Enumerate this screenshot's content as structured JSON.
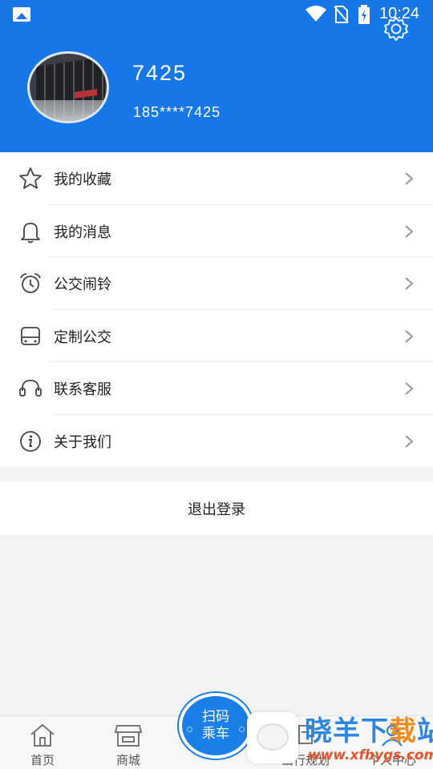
{
  "status_bar": {
    "time": "10:24"
  },
  "profile": {
    "username": "7425",
    "phone": "185****7425"
  },
  "menu": [
    {
      "label": "我的收藏",
      "icon": "star-icon"
    },
    {
      "label": "我的消息",
      "icon": "bell-icon"
    },
    {
      "label": "公交闹铃",
      "icon": "alarm-clock-icon"
    },
    {
      "label": "定制公交",
      "icon": "bus-icon"
    },
    {
      "label": "联系客服",
      "icon": "headset-icon"
    },
    {
      "label": "关于我们",
      "icon": "info-icon"
    }
  ],
  "logout_label": "退出登录",
  "tabbar": {
    "home": "首页",
    "mall": "商城",
    "scan_line1": "扫码",
    "scan_line2": "乘车",
    "trip": "出行规划",
    "center": "个人中心"
  },
  "watermark": {
    "title_blue": "晓羊下",
    "title_orange": "载",
    "title_end": "站",
    "url": "www.xfhygs.com"
  },
  "colors": {
    "header": "#1677e8",
    "accent": "#1a7fe6"
  }
}
